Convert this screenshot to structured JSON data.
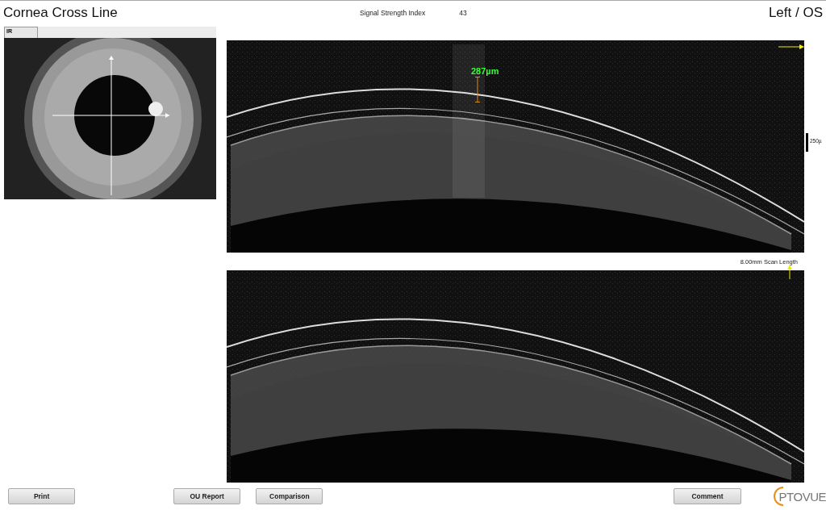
{
  "header": {
    "title": "Cornea Cross Line",
    "signal_label": "Signal Strength Index",
    "signal_value": "43",
    "eye": "Left / OS"
  },
  "ir_panel": {
    "tab": "IR"
  },
  "scans": [
    {
      "measurement": "287µm",
      "scale_label": "250µ"
    },
    {
      "caption": "8.00mm Scan Length"
    }
  ],
  "buttons": [
    "Print",
    "OU Report",
    "Comparison",
    "Comment"
  ],
  "logo": {
    "text": "PTOVUE"
  }
}
